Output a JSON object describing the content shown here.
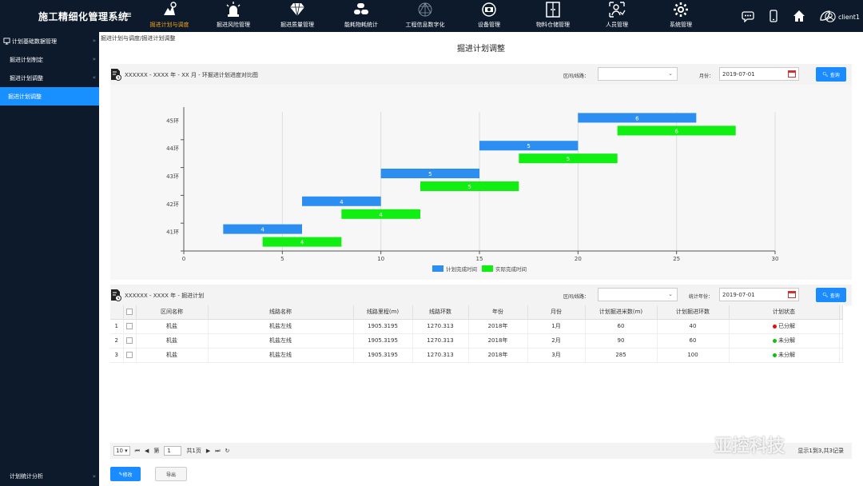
{
  "app": {
    "title": "施工精细化管理系统",
    "menu_icon": "hamburger-icon",
    "user": "client1"
  },
  "nav": [
    {
      "label": "掘进计划与调度",
      "icon": "worker-chart-icon",
      "active": true
    },
    {
      "label": "掘进风险管理",
      "icon": "alarm-light-icon"
    },
    {
      "label": "掘进质量管理",
      "icon": "diamond-icon"
    },
    {
      "label": "能耗物耗统计",
      "icon": "cylinders-icon"
    },
    {
      "label": "工程信息数字化",
      "icon": "network-sphere-icon"
    },
    {
      "label": "设备管理",
      "icon": "camera-device-icon"
    },
    {
      "label": "物料仓储管理",
      "icon": "warehouse-door-icon"
    },
    {
      "label": "人员管理",
      "icon": "person-id-icon"
    },
    {
      "label": "系统管理",
      "icon": "gear-icon"
    }
  ],
  "sidebar": {
    "items": [
      {
        "label": "计划基础数据管理"
      },
      {
        "label": "掘进计划制定"
      },
      {
        "label": "掘进计划调整"
      },
      {
        "label": "掘进计划调整"
      }
    ],
    "bottom": "计划统计分析"
  },
  "breadcrumb": "掘进计划与调度/掘进计划调整",
  "page_title": "掘进计划调整",
  "chart_panel": {
    "title": "XXXXXX - XXXX 年 - XX 月 - 环掘进计划进度对比图",
    "filter_label": "区间/线路：",
    "month_label": "月份：",
    "month_value": "2019-07-01",
    "query_label": "查询"
  },
  "chart_data": {
    "type": "bar",
    "orientation": "horizontal",
    "categories": [
      "41环",
      "42环",
      "43环",
      "44环",
      "45环"
    ],
    "xlim": [
      0,
      30
    ],
    "xticks": [
      0,
      5,
      10,
      15,
      20,
      25,
      30
    ],
    "grid": true,
    "legend_position": "bottom",
    "series": [
      {
        "name": "计划完成时间",
        "color": "#2b8ef0",
        "bars": [
          {
            "start": 2,
            "end": 6,
            "label": "4"
          },
          {
            "start": 6,
            "end": 10,
            "label": "4"
          },
          {
            "start": 10,
            "end": 15,
            "label": "5"
          },
          {
            "start": 15,
            "end": 20,
            "label": "5"
          },
          {
            "start": 20,
            "end": 26,
            "label": "6"
          }
        ]
      },
      {
        "name": "实际完成时间",
        "color": "#11ee11",
        "bars": [
          {
            "start": 4,
            "end": 8,
            "label": "4"
          },
          {
            "start": 8,
            "end": 12,
            "label": "4"
          },
          {
            "start": 12,
            "end": 17,
            "label": "5"
          },
          {
            "start": 17,
            "end": 22,
            "label": "5"
          },
          {
            "start": 22,
            "end": 28,
            "label": "6"
          }
        ]
      }
    ]
  },
  "table_panel": {
    "title": "XXXXXX - XXXX 年 - 掘进计划",
    "filter_label": "区间/线路：",
    "year_label": "统计年份：",
    "year_value": "2019-07-01",
    "query_label": "查询"
  },
  "table": {
    "columns": [
      "区间名称",
      "线路名称",
      "线路里程(m)",
      "线路环数",
      "年份",
      "月份",
      "计划掘进米数(m)",
      "计划掘进环数",
      "计划状态"
    ],
    "rows": [
      {
        "num": "1",
        "cells": [
          "机盐",
          "机盐左线",
          "1905.3195",
          "1270.313",
          "2018年",
          "1月",
          "60",
          "40"
        ],
        "status": "已分解",
        "status_color": "#e01010"
      },
      {
        "num": "2",
        "cells": [
          "机盐",
          "机盐左线",
          "1905.3195",
          "1270.313",
          "2018年",
          "2月",
          "90",
          "60"
        ],
        "status": "未分解",
        "status_color": "#10c010"
      },
      {
        "num": "3",
        "cells": [
          "机盐",
          "机盐左线",
          "1905.3195",
          "1270.313",
          "2018年",
          "3月",
          "285",
          "100"
        ],
        "status": "未分解",
        "status_color": "#10c010"
      }
    ]
  },
  "pager": {
    "page_size": "10",
    "page_prefix": "第",
    "page_value": "1",
    "page_total": "共1页",
    "info": "显示1到3,共3记录"
  },
  "actions": {
    "edit_label": "修改",
    "export_label": "导出"
  },
  "watermark": "亚控科技"
}
